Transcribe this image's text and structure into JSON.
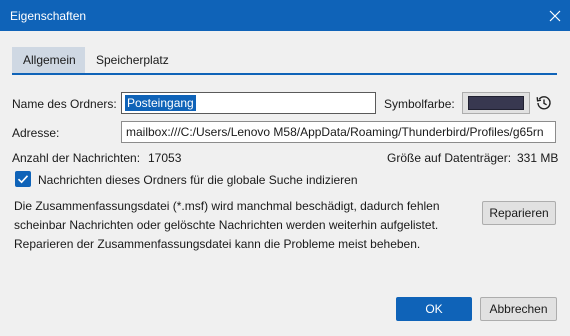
{
  "window": {
    "title": "Eigenschaften",
    "close_icon": "close-icon"
  },
  "tabs": [
    {
      "label": "Allgemein",
      "active": true
    },
    {
      "label": "Speicherplatz",
      "active": false
    }
  ],
  "form": {
    "name_label": "Name des Ordners:",
    "name_value": "Posteingang",
    "color_label": "Symbolfarbe:",
    "color_value": "#383850",
    "restore_icon": "history-icon",
    "address_label": "Adresse:",
    "address_value": "mailbox:///C:/Users/Lenovo M58/AppData/Roaming/Thunderbird/Profiles/g65rn",
    "count_label": "Anzahl der Nachrichten:",
    "count_value": "17053",
    "size_label": "Größe auf Datenträger:",
    "size_value": "331 MB"
  },
  "index_checkbox": {
    "checked": true,
    "label": "Nachrichten dieses Ordners für die globale Suche indizieren"
  },
  "repair": {
    "description_lines": [
      "Die Zusammenfassungsdatei (*.msf) wird manchmal beschädigt, dadurch fehlen",
      "scheinbar Nachrichten oder gelöschte Nachrichten werden weiterhin aufgelistet.",
      "Reparieren der Zusammenfassungsdatei kann die Probleme meist beheben."
    ],
    "button_label": "Reparieren"
  },
  "footer": {
    "ok_label": "OK",
    "cancel_label": "Abbrechen"
  },
  "colors": {
    "accent": "#0f63b8",
    "background": "#f0f0f0"
  }
}
